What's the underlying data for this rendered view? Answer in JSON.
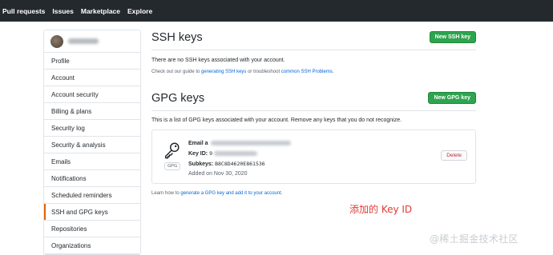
{
  "topnav": {
    "items": [
      "Pull requests",
      "Issues",
      "Marketplace",
      "Explore"
    ]
  },
  "sidebar": {
    "items": [
      {
        "label": "Profile"
      },
      {
        "label": "Account"
      },
      {
        "label": "Account security"
      },
      {
        "label": "Billing & plans"
      },
      {
        "label": "Security log"
      },
      {
        "label": "Security & analysis"
      },
      {
        "label": "Emails"
      },
      {
        "label": "Notifications"
      },
      {
        "label": "Scheduled reminders"
      },
      {
        "label": "SSH and GPG keys",
        "active": true
      },
      {
        "label": "Repositories"
      },
      {
        "label": "Organizations"
      }
    ]
  },
  "ssh": {
    "title": "SSH keys",
    "new_button": "New SSH key",
    "empty_text": "There are no SSH keys associated with your account.",
    "guide_prefix": "Check out our guide to ",
    "guide_link1": "generating SSH keys",
    "guide_mid": " or troubleshoot ",
    "guide_link2": "common SSH Problems",
    "guide_suffix": "."
  },
  "gpg": {
    "title": "GPG keys",
    "new_button": "New GPG key",
    "description": "This is a list of GPG keys associated with your account. Remove any keys that you do not recognize.",
    "key": {
      "badge": "GPG",
      "email_label": "Email a",
      "keyid_label": "Key ID: ",
      "keyid_prefix": "9",
      "subkeys_label": "Subkeys: ",
      "subkeys_value": "B8C8D4620E861536",
      "added": "Added on Nov 30, 2020",
      "delete_button": "Delete"
    },
    "learn_prefix": "Learn how to ",
    "learn_link": "generate a GPG key and add it to your account",
    "learn_suffix": "."
  },
  "annotation": "添加的 Key ID",
  "watermark": "@稀土掘金技术社区"
}
